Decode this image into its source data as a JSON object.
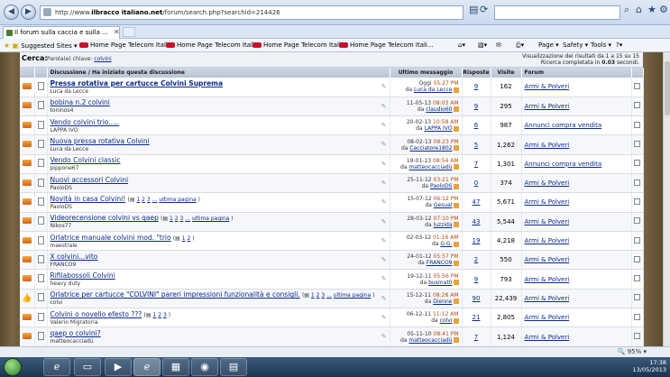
{
  "browser": {
    "url_prefix": "http://www.",
    "url_domain": "ilbracco italiano.net",
    "url_path": "/forum/search.php?searchid=214426",
    "tab_title": "Il forum sulla caccia e sulla ...",
    "favorites": [
      {
        "label": "Suggested Sites",
        "arrow": "▾"
      },
      {
        "label": "Home Page Telecom Itali..."
      },
      {
        "label": "Home Page Telecom Itali..."
      },
      {
        "label": "Home Page Telecom Itali..."
      },
      {
        "label": "Home Page Telecom Itali..."
      }
    ],
    "commands": {
      "page": "Page",
      "safety": "Safety",
      "tools": "Tools"
    },
    "zoom": "95%"
  },
  "search": {
    "cerca_label": "Cerca:",
    "keyword_label": "Parola(e) chiave:",
    "keyword": "colvini",
    "summary_line1": "Visualizzazione dei risultati da 1 a 15 su 15",
    "summary_line2_prefix": "Ricerca completata in",
    "summary_time": "0.03",
    "summary_line2_suffix": "secondi."
  },
  "columns": {
    "topic": "Discussione / Ha iniziato questa discussione",
    "last_post": "Ultimo messaggio",
    "replies": "Risposte",
    "views": "Visite",
    "forum": "Forum"
  },
  "rows": [
    {
      "title": "Pressa rotativa per cartucce Colvini Suprema",
      "bold": true,
      "starter": "Luca da Lecce",
      "date": "Oggi",
      "time": "05:27 PM",
      "by": "Luca da Lecce",
      "replies": "9",
      "views": "162",
      "forum": "Armi & Polveri",
      "pages": []
    },
    {
      "title": "bobina n.2 colvini",
      "starter": "toninos4",
      "date": "11-05-13",
      "time": "08:03 AM",
      "by": "claudio60",
      "replies": "9",
      "views": "295",
      "forum": "Armi & Polveri",
      "pages": []
    },
    {
      "title": "Vendo colvini trio.....",
      "starter": "LAPPA IVO",
      "date": "20-02-13",
      "time": "10:58 AM",
      "by": "LAPPA IVO",
      "replies": "6",
      "views": "987",
      "forum": "Annunci compra vendita",
      "pages": []
    },
    {
      "title": "Nuova pressa rotativa Colvini",
      "starter": "Luca da Lecce",
      "date": "08-02-13",
      "time": "08:23 PM",
      "by": "Cacciatore1802",
      "replies": "5",
      "views": "1,262",
      "forum": "Armi & Polveri",
      "pages": []
    },
    {
      "title": "Vendo Colvini classic",
      "starter": "pippone67",
      "date": "19-01-13",
      "time": "08:54 AM",
      "by": "matteocacciadü",
      "replies": "7",
      "views": "1,301",
      "forum": "Annunci compra vendita",
      "pages": []
    },
    {
      "title": "Nuovi accessori Colvini",
      "starter": "PaoloDS",
      "date": "25-11-12",
      "time": "03:21 PM",
      "by": "PaoloDS",
      "replies": "0",
      "views": "374",
      "forum": "Armi & Polveri",
      "pages": []
    },
    {
      "title": "Novità in casa Colvini!",
      "starter": "PaoloDS",
      "date": "15-07-12",
      "time": "06:12 PM",
      "by": "Gesual",
      "replies": "47",
      "views": "5,671",
      "forum": "Armi & Polveri",
      "pages": [
        "1",
        "2",
        "3",
        "...",
        "ultima pagina"
      ]
    },
    {
      "title": "Videorecensione colvini vs qaep",
      "starter": "Nikos77",
      "date": "28-03-12",
      "time": "07:10 PM",
      "by": "luzzida",
      "replies": "43",
      "views": "5,544",
      "forum": "Armi & Polveri",
      "pages": [
        "1",
        "2",
        "3",
        "...",
        "ultima pagina"
      ]
    },
    {
      "title": "Orlatrice manuale colvini mod. \"trio",
      "starter": "maestrale",
      "date": "02-03-12",
      "time": "01:16 AM",
      "by": "G.G.",
      "replies": "19",
      "views": "4,218",
      "forum": "Armi & Polveri",
      "pages": [
        "1",
        "2"
      ]
    },
    {
      "title": "X colvini...vito",
      "starter": "FRANCO9",
      "date": "24-01-12",
      "time": "05:57 PM",
      "by": "FRANCO9",
      "replies": "2",
      "views": "550",
      "forum": "Armi & Polveri",
      "pages": []
    },
    {
      "title": "Rifilabossoli Colvini",
      "starter": "heavy duty",
      "date": "19-12-11",
      "time": "05:56 PM",
      "by": "busmat0",
      "replies": "9",
      "views": "793",
      "forum": "Armi & Polveri",
      "pages": []
    },
    {
      "title": "Orlatrice per cartucce \"COLVINI\" pareri impressioni funzionalità e consigli.",
      "starter": "colvi",
      "thumb": true,
      "date": "15-12-11",
      "time": "08:28 AM",
      "by": "Dienne",
      "replies": "90",
      "views": "22,439",
      "forum": "Armi & Polveri",
      "pages": [
        "1",
        "2",
        "3",
        "...",
        "ultima pagina"
      ]
    },
    {
      "title": "Colvini o novello efesto ???",
      "starter": "Valerio Migratoria",
      "date": "06-12-11",
      "time": "11:12 AM",
      "by": "colvi",
      "replies": "21",
      "views": "2,805",
      "forum": "Armi & Polveri",
      "pages": [
        "1",
        "2",
        "3"
      ]
    },
    {
      "title": "qaep o colvini?",
      "starter": "matteocacciadü",
      "date": "05-11-10",
      "time": "08:41 PM",
      "by": "matteocacciadü",
      "replies": "7",
      "views": "1,124",
      "forum": "Armi & Polveri",
      "pages": []
    }
  ],
  "labels": {
    "by_prefix": "da",
    "page_prefix": "("
  },
  "taskbar": {
    "time": "17:38",
    "date": "13/05/2013"
  }
}
